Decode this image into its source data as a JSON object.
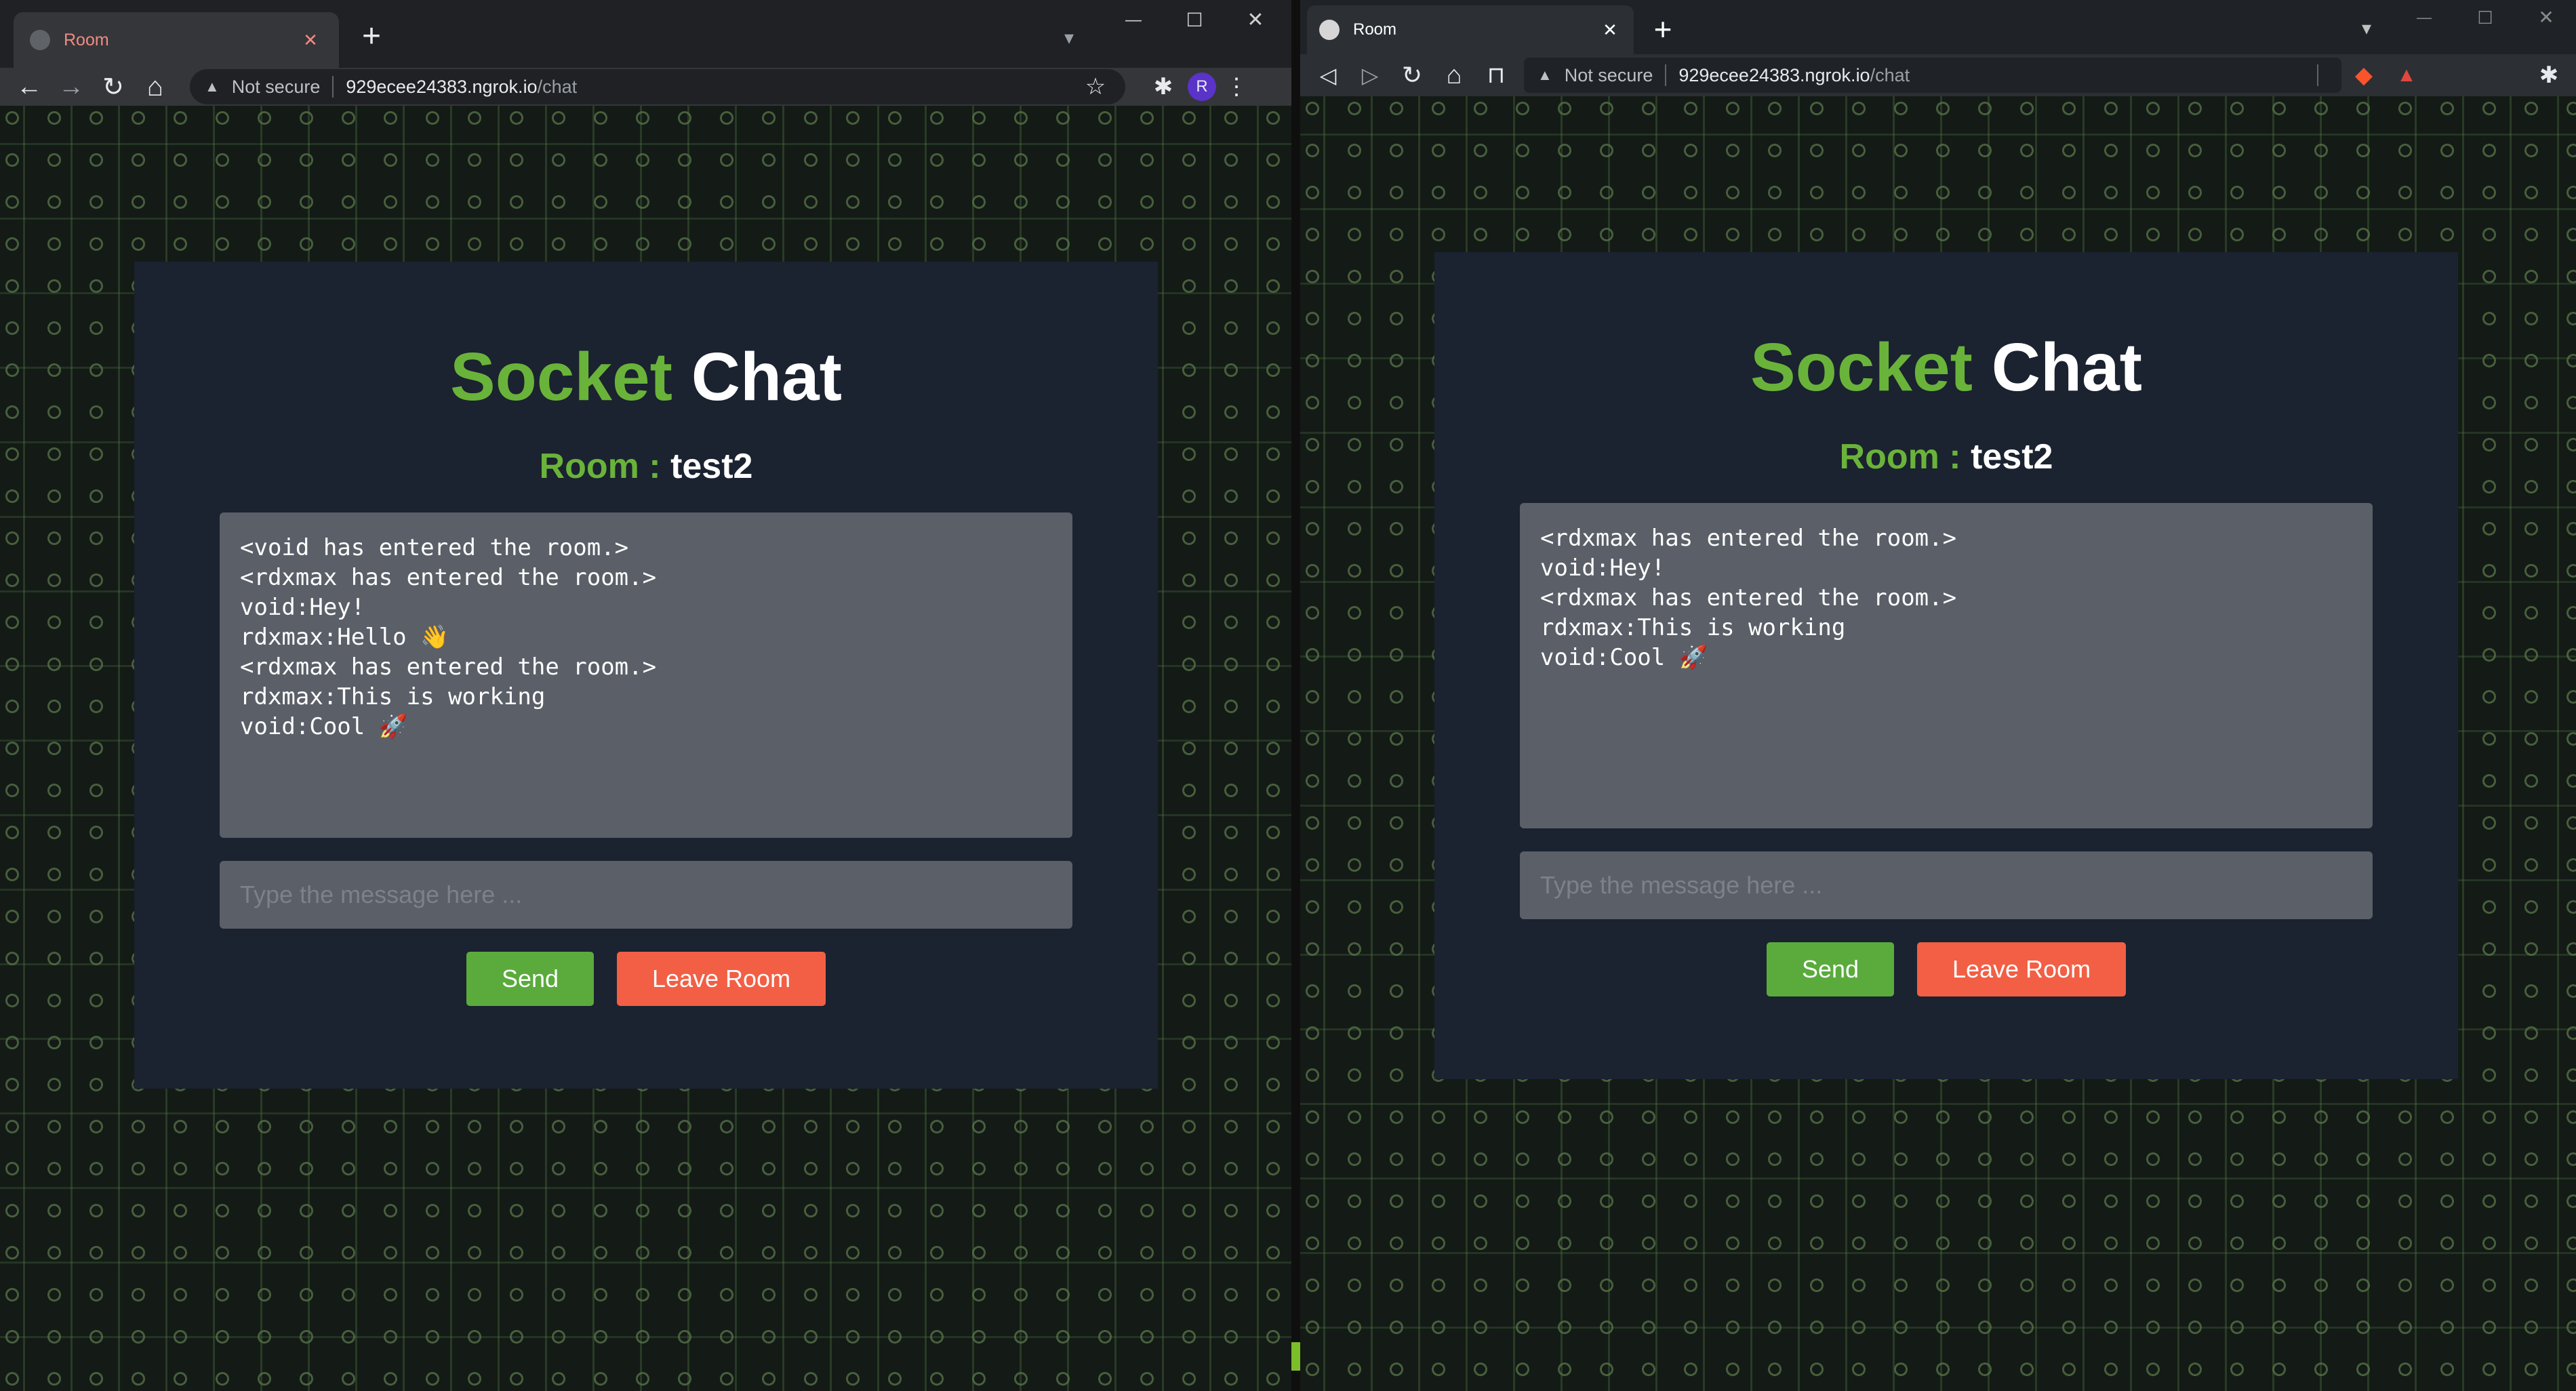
{
  "left": {
    "tab": {
      "title": "Room",
      "close": "✕",
      "new": "+"
    },
    "window_controls": {
      "minimize": "—",
      "maximize": "☐",
      "close": "✕",
      "menu": "▾"
    },
    "nav": {
      "back": "←",
      "forward": "→",
      "reload": "↻",
      "home": "⌂"
    },
    "address": {
      "warning": "▲",
      "security": "Not secure",
      "host": "929ecee24383.ngrok.io",
      "path": "/chat"
    },
    "toolbar": {
      "star": "☆",
      "extensions": "✱",
      "profile": "R",
      "menu": "⋮"
    },
    "app": {
      "brand_green": "Socket",
      "brand_white": "Chat",
      "room_label": "Room : ",
      "room_name": "test2",
      "messages": [
        "<void has entered the room.>",
        "<rdxmax has entered the room.>",
        "void:Hey!",
        "rdxmax:Hello 👋",
        "<rdxmax has entered the room.>",
        "rdxmax:This is working",
        "void:Cool 🚀"
      ],
      "input_placeholder": "Type the message here ...",
      "send_label": "Send",
      "leave_label": "Leave Room"
    }
  },
  "right": {
    "tab": {
      "title": "Room",
      "close": "✕",
      "new": "+"
    },
    "window_controls": {
      "minimize": "—",
      "maximize": "☐",
      "close": "✕",
      "menu": "▾"
    },
    "nav": {
      "back": "◁",
      "forward": "▷",
      "reload": "↻",
      "home": "⌂",
      "bookmark": "⊓"
    },
    "address": {
      "warning": "▲",
      "security": "Not secure",
      "host": "929ecee24383.ngrok.io",
      "path": "/chat"
    },
    "toolbar": {
      "brave": "◆",
      "rewards": "▲",
      "extensions": "✱",
      "menu": "≡"
    },
    "app": {
      "brand_green": "Socket",
      "brand_white": "Chat",
      "room_label": "Room : ",
      "room_name": "test2",
      "messages": [
        "<rdxmax has entered the room.>",
        "void:Hey!",
        "<rdxmax has entered the room.>",
        "rdxmax:This is working",
        "void:Cool 🚀"
      ],
      "input_placeholder": "Type the message here ...",
      "send_label": "Send",
      "leave_label": "Leave Room"
    }
  },
  "colors": {
    "brand_green": "#6ab33a",
    "send": "#5aab3c",
    "leave": "#f25f45",
    "panel": "#1b2230",
    "log_bg": "#5a5f68"
  }
}
